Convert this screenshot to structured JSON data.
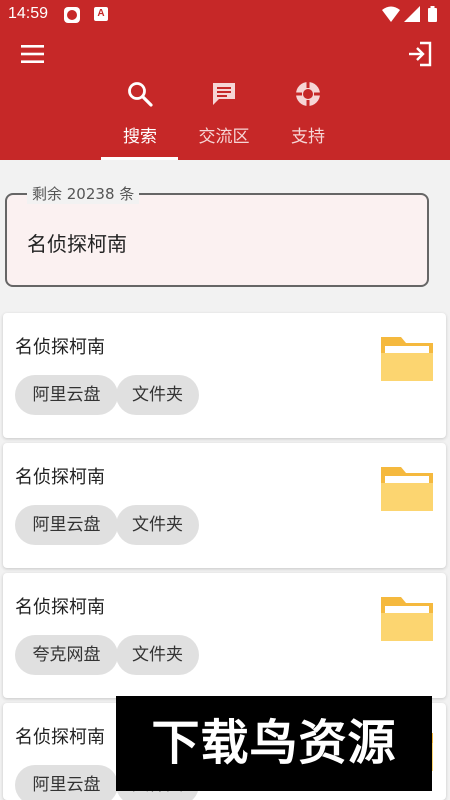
{
  "status_bar": {
    "time": "14:59",
    "icons": [
      "record-icon",
      "a-icon",
      "wifi-icon",
      "signal-icon",
      "battery-icon"
    ]
  },
  "app_bar": {
    "color": "#c62828",
    "menu_icon": "menu-icon",
    "logout_icon": "logout-icon",
    "tabs": [
      {
        "label": "搜索",
        "icon": "search-icon",
        "active": true
      },
      {
        "label": "交流区",
        "icon": "chat-icon",
        "active": false
      },
      {
        "label": "支持",
        "icon": "lifebuoy-icon",
        "active": false
      }
    ]
  },
  "search": {
    "legend": "剩余 20238 条",
    "value": "名侦探柯南"
  },
  "results": [
    {
      "title": "名侦探柯南",
      "tags": [
        "阿里云盘",
        "文件夹"
      ],
      "icon": "folder-icon"
    },
    {
      "title": "名侦探柯南",
      "tags": [
        "阿里云盘",
        "文件夹"
      ],
      "icon": "folder-icon"
    },
    {
      "title": "名侦探柯南",
      "tags": [
        "夸克网盘",
        "文件夹"
      ],
      "icon": "folder-icon"
    },
    {
      "title": "名侦探柯南",
      "tags": [
        "阿里云盘",
        "文件夹"
      ],
      "icon": "folder-icon"
    }
  ],
  "watermark": "下载鸟资源"
}
